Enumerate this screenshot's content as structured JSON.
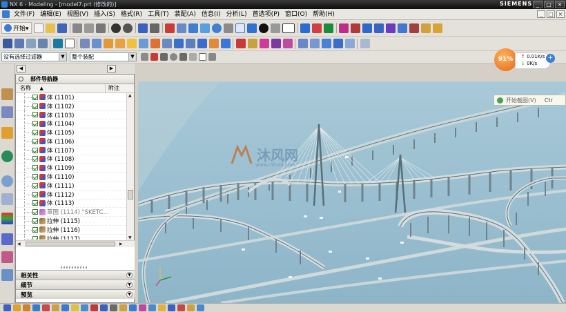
{
  "window": {
    "title": "NX 6 - Modeling - [model7.prt (修改的)]",
    "brand": "SIEMENS",
    "buttons": [
      "_",
      "□",
      "×"
    ]
  },
  "menubar": {
    "items": [
      "文件(F)",
      "编辑(E)",
      "视图(V)",
      "插入(S)",
      "格式(R)",
      "工具(T)",
      "装配(A)",
      "信息(I)",
      "分析(L)",
      "首选项(P)",
      "窗口(O)",
      "帮助(H)"
    ],
    "mdi_buttons": [
      "_",
      "□",
      "×"
    ]
  },
  "toolbar": {
    "start_label": "开始▾"
  },
  "selection": {
    "filter_value": "没有选择过滤器",
    "scope_value": "整个装配"
  },
  "network_meter": {
    "percent": "91%",
    "upload_rate": "0.01K/s",
    "download_rate": "0K/s"
  },
  "part_navigator": {
    "title": "部件导航器",
    "col_name": "名称",
    "col_note": "附注",
    "rows": [
      {
        "type": "body",
        "label": "体 (1101)"
      },
      {
        "type": "body",
        "label": "体 (1102)"
      },
      {
        "type": "body",
        "label": "体 (1103)"
      },
      {
        "type": "body",
        "label": "体 (1104)"
      },
      {
        "type": "body",
        "label": "体 (1105)"
      },
      {
        "type": "body",
        "label": "体 (1106)"
      },
      {
        "type": "body",
        "label": "体 (1107)"
      },
      {
        "type": "body",
        "label": "体 (1108)"
      },
      {
        "type": "body",
        "label": "体 (1109)"
      },
      {
        "type": "body",
        "label": "体 (1110)"
      },
      {
        "type": "body",
        "label": "体 (1111)"
      },
      {
        "type": "body",
        "label": "体 (1112)"
      },
      {
        "type": "body",
        "label": "体 (1113)"
      },
      {
        "type": "sketch",
        "label": "草图 (1114) \"SKETC..."
      },
      {
        "type": "ext",
        "label": "拉伸 (1115)"
      },
      {
        "type": "ext",
        "label": "拉伸 (1116)"
      },
      {
        "type": "ext",
        "label": "拉伸 (1117)"
      }
    ],
    "sections": [
      "相关性",
      "细节",
      "预览"
    ]
  },
  "screenshot_tooltip": {
    "label": "开始截图(V)",
    "shortcut": "Ctr"
  },
  "watermark": {
    "text": "沐风网",
    "url": "www.mfcad.com"
  }
}
